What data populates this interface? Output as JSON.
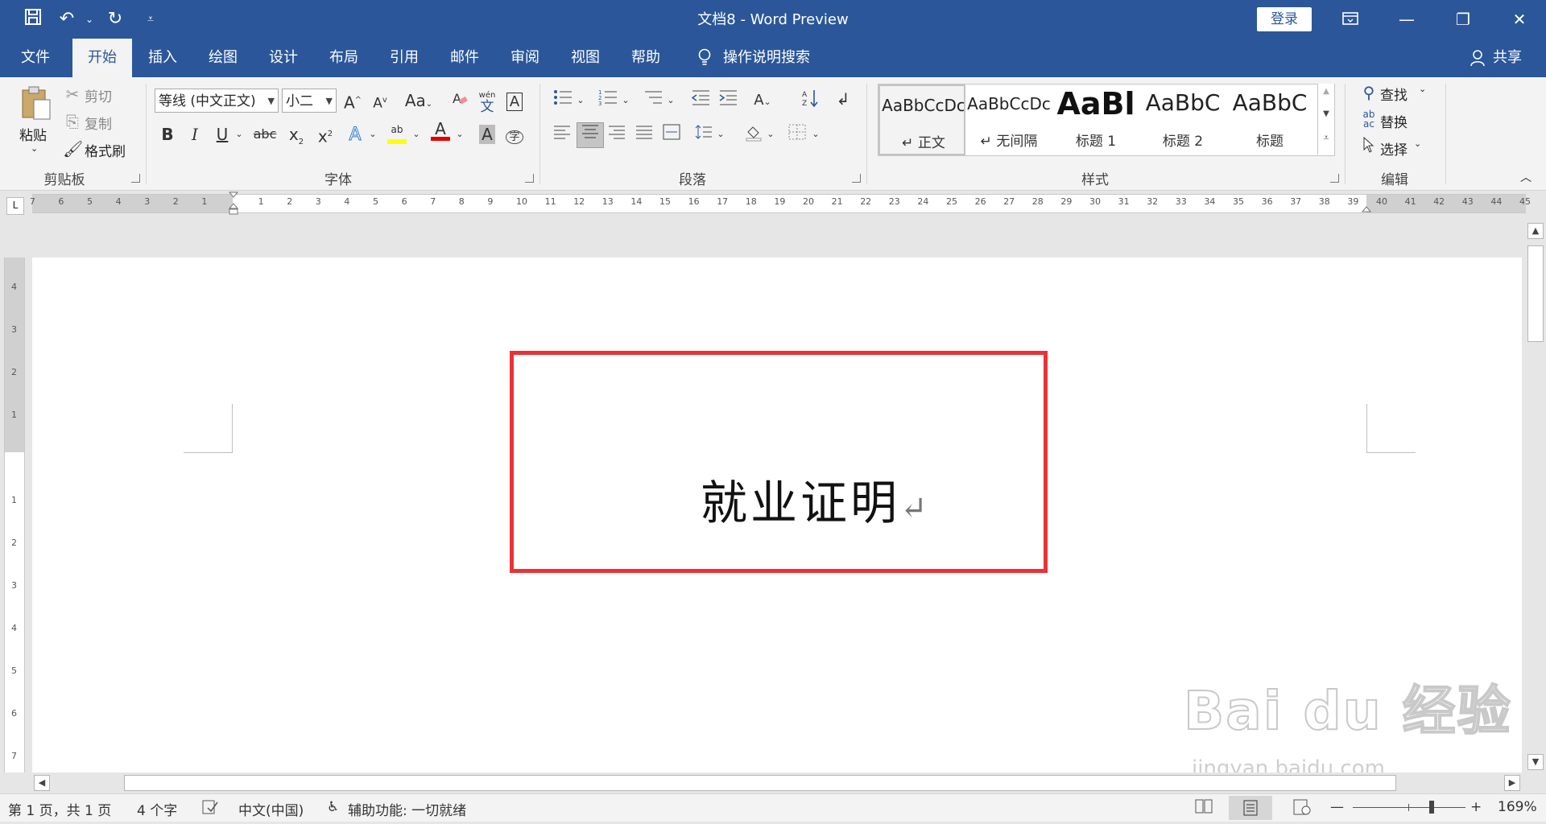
{
  "titlebar": {
    "doc_title": "文档8 - Word Preview",
    "login": "登录"
  },
  "tabs": [
    {
      "label": "文件"
    },
    {
      "label": "开始"
    },
    {
      "label": "插入"
    },
    {
      "label": "绘图"
    },
    {
      "label": "设计"
    },
    {
      "label": "布局"
    },
    {
      "label": "引用"
    },
    {
      "label": "邮件"
    },
    {
      "label": "审阅"
    },
    {
      "label": "视图"
    },
    {
      "label": "帮助"
    },
    {
      "label": "操作说明搜索"
    },
    {
      "label": "共享"
    }
  ],
  "clipboard": {
    "paste": "粘贴",
    "cut": "剪切",
    "copy": "复制",
    "format_painter": "格式刷",
    "group_label": "剪贴板"
  },
  "font": {
    "font_name": "等线 (中文正文)",
    "font_size": "小二",
    "grow": "A",
    "shrink": "A",
    "case": "Aa",
    "phonetic_top": "wén",
    "phonetic_bottom": "文",
    "border_char": "A",
    "bold": "B",
    "italic": "I",
    "underline": "U",
    "strike": "abc",
    "subscript": "x",
    "subscript_small": "2",
    "superscript": "x",
    "superscript_small": "2",
    "highlight_letters": "ab",
    "font_color_letter": "A",
    "char_shading_letter": "A",
    "enclose_char": "字",
    "group_label": "字体"
  },
  "paragraph": {
    "group_label": "段落"
  },
  "styles": {
    "items": [
      {
        "sample": "AaBbCcDc",
        "name": "↵ 正文"
      },
      {
        "sample": "AaBbCcDc",
        "name": "↵ 无间隔"
      },
      {
        "sample": "AaBl",
        "name": "标题 1"
      },
      {
        "sample": "AaBbC",
        "name": "标题 2"
      },
      {
        "sample": "AaBbC",
        "name": "标题"
      }
    ],
    "group_label": "样式"
  },
  "editing": {
    "find": "查找",
    "replace": "替换",
    "select": "选择",
    "group_label": "编辑"
  },
  "ruler": {
    "left_labels": [
      "7",
      "6",
      "5",
      "4",
      "3",
      "2",
      "1"
    ],
    "right_labels": [
      "1",
      "2",
      "3",
      "4",
      "5",
      "6",
      "7",
      "8",
      "9",
      "10",
      "11",
      "12",
      "13",
      "14",
      "15",
      "16",
      "17",
      "18",
      "19",
      "20",
      "21",
      "22",
      "23",
      "24",
      "25",
      "26",
      "27",
      "28",
      "29",
      "30",
      "31",
      "32",
      "33",
      "34",
      "35",
      "36",
      "37",
      "38",
      "39",
      "40",
      "41",
      "42",
      "43",
      "44",
      "45"
    ],
    "tab_selector": "L"
  },
  "document": {
    "heading": "就业证明",
    "para_mark": "↵"
  },
  "statusbar": {
    "page": "第 1 页，共 1 页",
    "words": "4 个字",
    "language": "中文(中国)",
    "accessibility": "辅助功能: 一切就绪",
    "zoom": "169%",
    "zoom_level_fraction": 0.7
  },
  "watermark": {
    "main": "Bai du 经验",
    "sub": "jingyan.baidu.com"
  },
  "colors": {
    "brand": "#2b579a",
    "highlight_box": "#ea3237",
    "highlight_color": "#ffff00",
    "font_color": "#e00000"
  }
}
